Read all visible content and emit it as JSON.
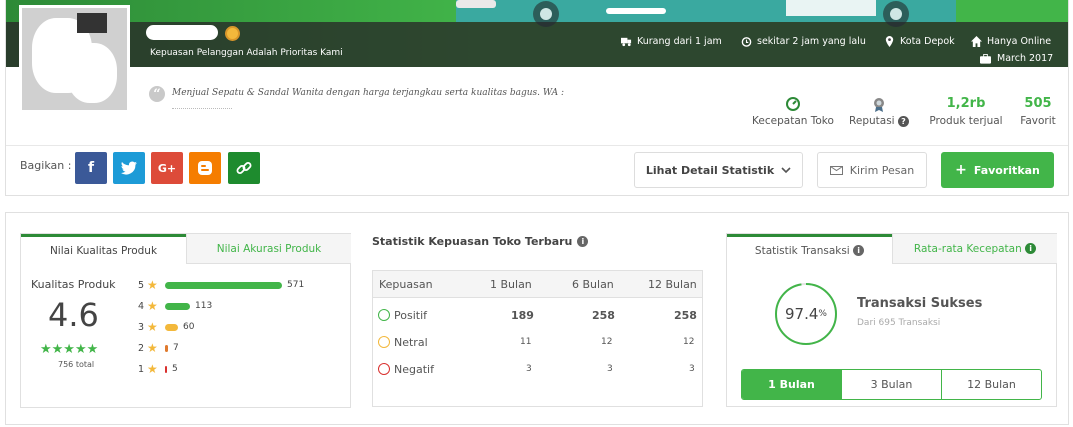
{
  "shop": {
    "tagline": "Kepuasan Pelanggan Adalah Prioritas Kami",
    "meta": {
      "delivery": "Kurang dari 1 jam",
      "last_online": "sekitar 2 jam yang lalu",
      "city": "Kota Depok",
      "channel": "Hanya Online",
      "since": "March 2017"
    },
    "description": "Menjual Sepatu & Sandal Wanita dengan harga terjangkau serta kualitas bagus. WA :",
    "stats": {
      "speed_label": "Kecepatan Toko",
      "reputation_label": "Reputasi",
      "sold_value": "1,2rb",
      "sold_label": "Produk terjual",
      "favorite_value": "505",
      "favorite_label": "Favorit"
    }
  },
  "share": {
    "label": "Bagikan :",
    "icons": [
      "facebook-icon",
      "twitter-icon",
      "google-plus-icon",
      "blogger-icon",
      "link-icon"
    ]
  },
  "actions": {
    "detail_stat": "Lihat Detail Statistik",
    "send_message": "Kirim Pesan",
    "favorite": "Favoritkan"
  },
  "quality": {
    "tabs": [
      "Nilai Kualitas Produk",
      "Nilai Akurasi Produk"
    ],
    "title": "Kualitas Produk",
    "score": "4.6",
    "total": "756 total",
    "stars": "★★★★★",
    "ratings": [
      {
        "star": "5",
        "count": "571",
        "share": 0.755
      },
      {
        "star": "4",
        "count": "113",
        "share": 0.149
      },
      {
        "star": "3",
        "count": "60",
        "share": 0.079
      },
      {
        "star": "2",
        "count": "7",
        "share": 0.009
      },
      {
        "star": "1",
        "count": "5",
        "share": 0.007
      }
    ]
  },
  "satisfaction": {
    "title": "Statistik Kepuasan Toko Terbaru",
    "headers": [
      "Kepuasan",
      "1 Bulan",
      "6 Bulan",
      "12 Bulan"
    ],
    "rows": [
      {
        "label": "Positif",
        "values": [
          "189",
          "258",
          "258"
        ]
      },
      {
        "label": "Netral",
        "values": [
          "11",
          "12",
          "12"
        ]
      },
      {
        "label": "Negatif",
        "values": [
          "3",
          "3",
          "3"
        ]
      }
    ]
  },
  "transactions": {
    "tabs": [
      "Statistik Transaksi",
      "Rata-rata Kecepatan"
    ],
    "percent": "97.4",
    "percent_unit": "%",
    "title": "Transaksi Sukses",
    "subtitle": "Dari 695 Transaksi",
    "periods": [
      "1 Bulan",
      "3 Bulan",
      "12 Bulan"
    ],
    "active_period": "1 Bulan"
  },
  "colors": {
    "accent": "#42b549",
    "accent_dark": "#2d8a37",
    "star": "#f3b83b"
  }
}
